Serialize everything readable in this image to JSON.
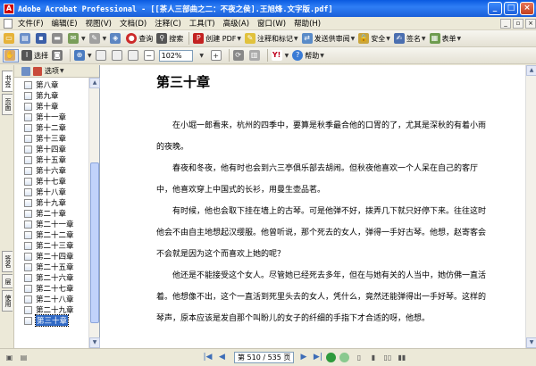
{
  "window": {
    "app_icon": "acrobat-icon",
    "title": "Adobe Acrobat Professional - [[茶人三部曲之二：不夜之侯].王旭烽.文字版.pdf]",
    "minimize": "_",
    "maximize": "□",
    "close": "×"
  },
  "menu": {
    "items": [
      "文件(F)",
      "编辑(E)",
      "视图(V)",
      "文档(D)",
      "注释(C)",
      "工具(T)",
      "高级(A)",
      "窗口(W)",
      "帮助(H)"
    ]
  },
  "toolbar1": {
    "items": [
      {
        "name": "open-icon",
        "label": ""
      },
      {
        "name": "organizer-icon",
        "label": ""
      },
      {
        "name": "save-icon",
        "label": ""
      },
      {
        "name": "print-icon",
        "label": ""
      },
      {
        "name": "email-icon",
        "label": ""
      },
      {
        "name": "sign-pen-icon",
        "label": ""
      },
      {
        "name": "secure-icon",
        "label": ""
      },
      {
        "name": "stop-icon",
        "label": "查询"
      },
      {
        "name": "search-icon",
        "label": "搜索"
      },
      {
        "name": "create-pdf-icon",
        "label": "创建 PDF"
      },
      {
        "name": "review-icon",
        "label": "注释和标记"
      },
      {
        "name": "send-review-icon",
        "label": "发送供审阅"
      },
      {
        "name": "lock-icon",
        "label": "安全"
      },
      {
        "name": "signature-icon",
        "label": "签名"
      },
      {
        "name": "forms-icon",
        "label": "表单"
      }
    ]
  },
  "toolbar2": {
    "select_label": "选择",
    "zoom": "102%",
    "help_label": "帮助"
  },
  "nav_tabs": [
    "书签",
    "页面",
    "签名",
    "层",
    "使用"
  ],
  "bookmarks": {
    "options_label": "选项",
    "items": [
      "第八章",
      "第九章",
      "第十章",
      "第十一章",
      "第十二章",
      "第十三章",
      "第十四章",
      "第十五章",
      "第十六章",
      "第十七章",
      "第十八章",
      "第十九章",
      "第二十章",
      "第二十一章",
      "第二十二章",
      "第二十三章",
      "第二十四章",
      "第二十五章",
      "第二十六章",
      "第二十七章",
      "第二十八章",
      "第二十九章",
      "第三十章"
    ],
    "selected_index": 22
  },
  "document": {
    "chapter_title": "第三十章",
    "paragraphs": [
      "在小堀一郎看来，杭州的四季中，要算是秋季最合他的口胃的了，尤其是深秋的有着小雨的夜晚。",
      "春夜和冬夜，他有时也会到六三亭俱乐部去胡闹。但秋夜他喜欢一个人呆在自己的客厅中，他喜欢穿上中国式的长衫，用曼生壶品茗。",
      "有时候，他也会取下挂在墙上的古琴。可是他弹不好，拨弄几下就只好停下来。往往这时他会不由自主地想起汉缨服。他曾听说，那个死去的女人，弹得一手好古琴。他想，赵寄客会不会就是因为这个而喜欢上她的呢？",
      "他还是不能接受这个女人。尽管她已经死去多年，但在与她有关的人当中，她仿佛一直活着。他想像不出，这个一直活到死里头去的女人，凭什么，竟然还能弹得出一手好琴。这样的琴声，原本应该是发自那个叫盼儿的女子的纤细的手指下才合适的呀，他想。"
    ]
  },
  "status": {
    "page_field": "第 510 / 535 页"
  }
}
